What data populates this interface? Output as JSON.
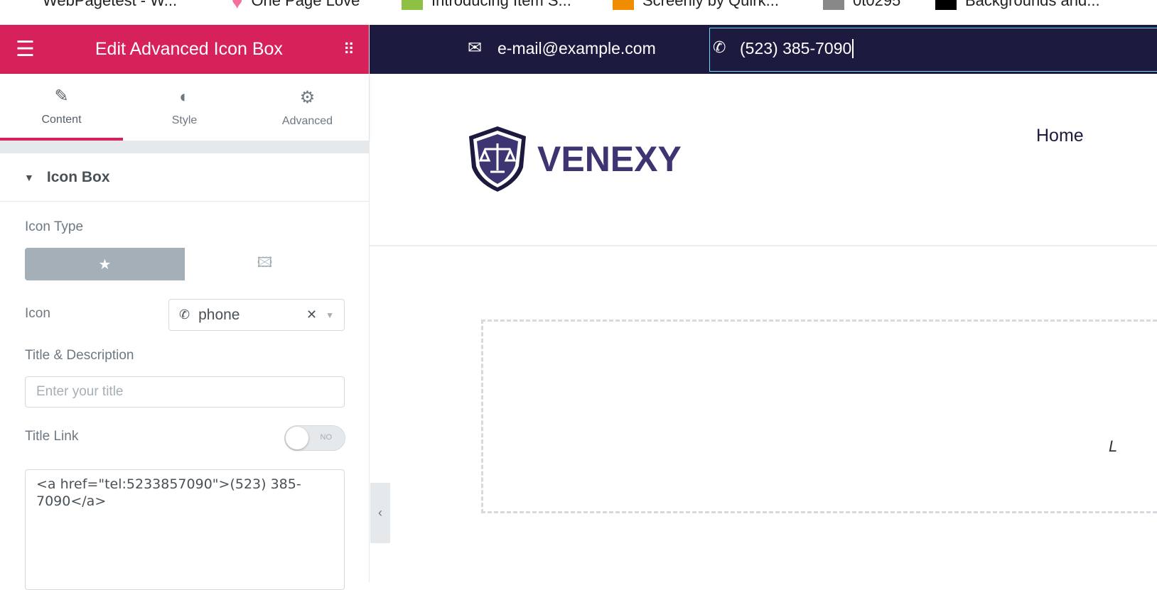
{
  "bookmarks": [
    "WebPagetest - W...",
    "One Page Love",
    "Introducing Item S...",
    "Screenly by Quirk...",
    "0t0295",
    "Backgrounds and..."
  ],
  "panel": {
    "title": "Edit Advanced Icon Box",
    "tabs": [
      "Content",
      "Style",
      "Advanced"
    ],
    "section": "Icon Box",
    "icon_type_label": "Icon Type",
    "icon_label": "Icon",
    "icon_value": "phone",
    "title_desc_label": "Title & Description",
    "title_placeholder": "Enter your title",
    "title_link_label": "Title Link",
    "toggle": "NO",
    "description": "<a href=\"tel:5233857090\">(523) 385-7090</a>"
  },
  "site": {
    "email": "e-mail@example.com",
    "phone": "(523) 385-7090",
    "logo": "VENEXY",
    "nav_home": "Home",
    "cut_text": "L"
  },
  "colors": {
    "accent": "#d6215a",
    "dark": "#1d1a40",
    "brand": "#3d3472"
  }
}
